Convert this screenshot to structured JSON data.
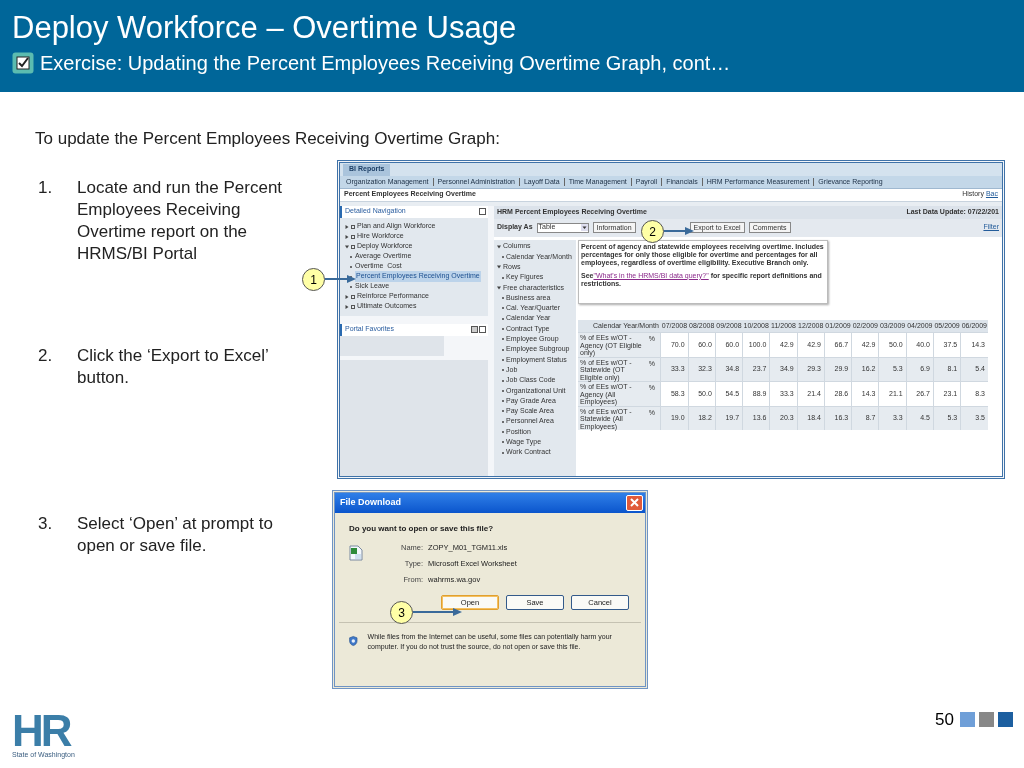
{
  "header": {
    "title": "Deploy Workforce – Overtime Usage",
    "subtitle": "Exercise: Updating the Percent Employees Receiving Overtime Graph, cont…"
  },
  "intro": "To update the Percent Employees Receiving Overtime Graph:",
  "steps": [
    {
      "number": "1.",
      "text": "Locate and run the Percent Employees Receiving Overtime report on the HRMS/BI Portal"
    },
    {
      "number": "2.",
      "text": "Click the ‘Export to Excel’ button."
    },
    {
      "number": "3.",
      "text": "Select ‘Open’  at prompt  to open  or save file."
    }
  ],
  "portal": {
    "tab": "BI Reports",
    "nav": [
      "Organization Management",
      "Personnel Administration",
      "Layoff Data",
      "Time Management",
      "Payroll",
      "Financials",
      "HRM Performance Measurement",
      "Grievance Reporting"
    ],
    "page_title": "Percent Employees Receiving Overtime",
    "history": "History",
    "back": "Bac",
    "detailed_navigation": "Detailed Navigation",
    "tree": [
      {
        "label": "Plan and Align Workforce",
        "expanded": false
      },
      {
        "label": "Hire Workforce",
        "expanded": false
      },
      {
        "label": "Deploy Workforce",
        "expanded": true,
        "children": [
          {
            "label": "Average Overtime",
            "selected": false
          },
          {
            "label": "Overtime  Cost",
            "selected": false
          },
          {
            "label": "Percent Employees Receiving Overtime",
            "selected": true
          },
          {
            "label": "Sick Leave",
            "selected": false
          }
        ]
      },
      {
        "label": "Reinforce Performance",
        "expanded": false
      },
      {
        "label": "Ultimate Outcomes",
        "expanded": false
      }
    ],
    "portal_favorites": "Portal Favorites",
    "report": {
      "title": "HRM Percent Employees Receiving Overtime",
      "last_update": "Last Data Update: 07/22/201",
      "display_as": "Display As",
      "display_value": "Table",
      "buttons": [
        "Information",
        "Export to Excel",
        "Comments"
      ],
      "filter": "Filter",
      "panel": [
        {
          "label": "Columns",
          "items": [
            "Calendar Year/Month"
          ]
        },
        {
          "label": "Rows",
          "items": [
            "Key Figures"
          ]
        },
        {
          "label": "Free characteristics",
          "items": [
            "Business area",
            "Cal. Year/Quarter",
            "Calendar Year",
            "Contract Type",
            "Employee Group",
            "Employee Subgroup",
            "Employment Status",
            "Job",
            "Job Class Code",
            "Organizational Unit",
            "Pay Grade Area",
            "Pay Scale Area",
            "Personnel Area",
            "Position",
            "Wage Type",
            "Work Contract"
          ]
        }
      ],
      "description": "Percent of agency and statewide employees receiving overtime.   Includes percentages for only those eligible for overtime and percentages for all employees, regardless of overtime eligibility.   Executive Branch only.",
      "see_prefix": "See",
      "see_link": "\"What's in the HRMS/BI data query?\"",
      "see_suffix": " for specific report definitions and restrictions.",
      "table": {
        "corner": "Calendar Year/Month",
        "months": [
          "07/2008",
          "08/2008",
          "09/2008",
          "10/2008",
          "11/2008",
          "12/2008",
          "01/2009",
          "02/2009",
          "03/2009",
          "04/2009",
          "05/2009",
          "06/2009"
        ],
        "rows": [
          {
            "label": "% of EEs w/OT - Agency (OT Eligible only)",
            "unit": "%",
            "values": [
              "70.0",
              "60.0",
              "60.0",
              "100.0",
              "42.9",
              "42.9",
              "66.7",
              "42.9",
              "50.0",
              "40.0",
              "37.5",
              "14.3"
            ]
          },
          {
            "label": "% of EEs w/OT - Statewide (OT Eligible only)",
            "unit": "%",
            "values": [
              "33.3",
              "32.3",
              "34.8",
              "23.7",
              "34.9",
              "29.3",
              "29.9",
              "16.2",
              "5.3",
              "6.9",
              "8.1",
              "5.4"
            ]
          },
          {
            "label": "% of EEs w/OT - Agency (All Employees)",
            "unit": "%",
            "values": [
              "58.3",
              "50.0",
              "54.5",
              "88.9",
              "33.3",
              "21.4",
              "28.6",
              "14.3",
              "21.1",
              "26.7",
              "23.1",
              "8.3"
            ]
          },
          {
            "label": "% of EEs w/OT - Statewide (All Employees)",
            "unit": "%",
            "values": [
              "19.0",
              "18.2",
              "19.7",
              "13.6",
              "20.3",
              "18.4",
              "16.3",
              "8.7",
              "3.3",
              "4.5",
              "5.3",
              "3.5"
            ]
          }
        ]
      }
    }
  },
  "dialog": {
    "title": "File Download",
    "question": "Do you want to open or save this file?",
    "fields": [
      {
        "label": "Name:",
        "value": "ZOPY_M01_TGM11.xls"
      },
      {
        "label": "Type:",
        "value": "Microsoft Excel Worksheet"
      },
      {
        "label": "From:",
        "value": "wahrms.wa.gov"
      }
    ],
    "buttons": [
      {
        "label": "Open",
        "selected": true
      },
      {
        "label": "Save",
        "selected": false
      },
      {
        "label": "Cancel",
        "selected": false
      }
    ],
    "warning": "While files from the Internet can be useful, some files can potentially harm your computer. If you do not trust the source, do not open or save this file."
  },
  "callouts": [
    "1",
    "2",
    "3"
  ],
  "footer": {
    "logo": "HR",
    "logo_caption": "State of Washington",
    "page": "50"
  }
}
